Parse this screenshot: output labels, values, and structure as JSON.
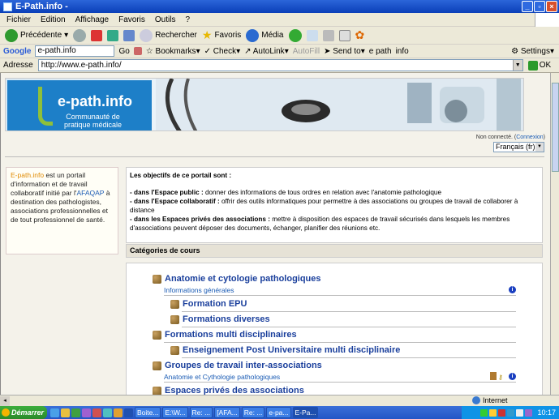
{
  "window": {
    "title": "E-Path.info -"
  },
  "menu": [
    "Fichier",
    "Edition",
    "Affichage",
    "Favoris",
    "Outils",
    "?"
  ],
  "toolbar": {
    "back": "Précédente",
    "search": "Rechercher",
    "favorites": "Favoris",
    "media": "Média"
  },
  "google": {
    "label": "Google",
    "search_value": "e-path.info",
    "go": "Go",
    "bookmarks": "Bookmarks",
    "check": "Check",
    "autolink": "AutoLink",
    "autofill": "AutoFill",
    "sendto": "Send to",
    "epath": "e path",
    "info": "info",
    "settings": "Settings"
  },
  "address": {
    "label": "Adresse",
    "url": "http://www.e-path.info/",
    "ok": "OK"
  },
  "banner": {
    "brand": "e-path.info",
    "subtitle_1": "Communauté de",
    "subtitle_2": "pratique médicale"
  },
  "status": {
    "prefix": "Non connecté. (",
    "link": "Connexion",
    "suffix": ")"
  },
  "language": {
    "selected": "Français (fr)"
  },
  "intro": {
    "name": "E-path.info",
    "text1": " est un portail d'information et de travail collaboratif initié par l'",
    "afaqap": "AFAQAP",
    "text2": " à destination des pathologistes, associations professionnelles et de tout professionnel de santé."
  },
  "objectives": {
    "heading": "Les objectifs de ce portail sont :",
    "p1_bold": "- dans l'Espace public : ",
    "p1": "donner des informations de tous ordres en relation avec l'anatomie pathologique",
    "p2_bold": "- dans l'Espace collaboratif : ",
    "p2": "offrir des outils informatiques pour permettre à des associations ou groupes de travail de collaborer à distance",
    "p3_bold": "- dans les Espaces privés des associations : ",
    "p3": "mettre à disposition des espaces de travail sécurisés dans lesquels les membres d'associations peuvent déposer des documents, échanger, planifier des réunions etc."
  },
  "categories": {
    "heading": "Catégories de cours",
    "items": [
      {
        "label": "Anatomie et cytologie pathologiques",
        "sub": "Informations générales"
      },
      {
        "label": "Formation EPU"
      },
      {
        "label": "Formations diverses"
      },
      {
        "label": "Formations multi disciplinaires"
      },
      {
        "label": "Enseignement Post Universitaire multi disciplinaire"
      },
      {
        "label": "Groupes de travail inter-associations",
        "sub": "Anatomie et Cythologie pathologiques"
      },
      {
        "label": "Espaces privés des associations"
      }
    ]
  },
  "statusbar": {
    "zone": "Internet"
  },
  "taskbar": {
    "start": "Démarrer",
    "tasks": [
      "Boite...",
      "E:\\W...",
      "Re: ...",
      "[AFA...",
      "Re: ...",
      "e-pa...",
      "E-Pa..."
    ],
    "clock": "10:17"
  }
}
